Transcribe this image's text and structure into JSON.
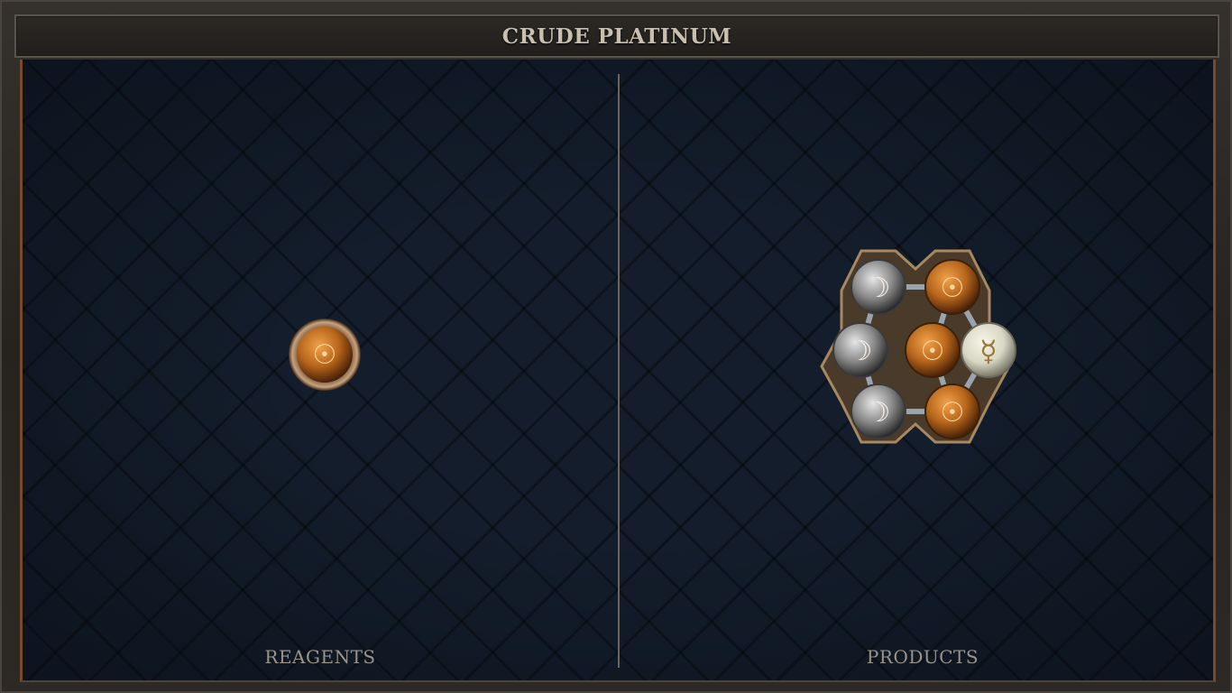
{
  "title": "CRUDE PLATINUM",
  "reagents_label": "REAGENTS",
  "products_label": "PRODUCTS",
  "reagents": [
    {
      "element": "salt",
      "icon": "salt-icon",
      "symbol": "☉"
    }
  ],
  "products": [
    {
      "element": "silver",
      "icon": "silver-icon",
      "symbol": "☽"
    },
    {
      "element": "salt",
      "icon": "salt-icon",
      "symbol": "☉"
    },
    {
      "element": "silver",
      "icon": "silver-icon",
      "symbol": "☽"
    },
    {
      "element": "salt",
      "icon": "salt-icon",
      "symbol": "☉"
    },
    {
      "element": "quicksilver",
      "icon": "quicksilver-icon",
      "symbol": "☿"
    },
    {
      "element": "silver",
      "icon": "silver-icon",
      "symbol": "☽"
    },
    {
      "element": "salt",
      "icon": "salt-icon",
      "symbol": "☉"
    }
  ],
  "colors": {
    "salt": "#b8661c",
    "silver": "#8a8a8a",
    "quicksilver": "#d8d6c4",
    "frame_accent": "#7a4a26",
    "board": "#131d2b"
  }
}
